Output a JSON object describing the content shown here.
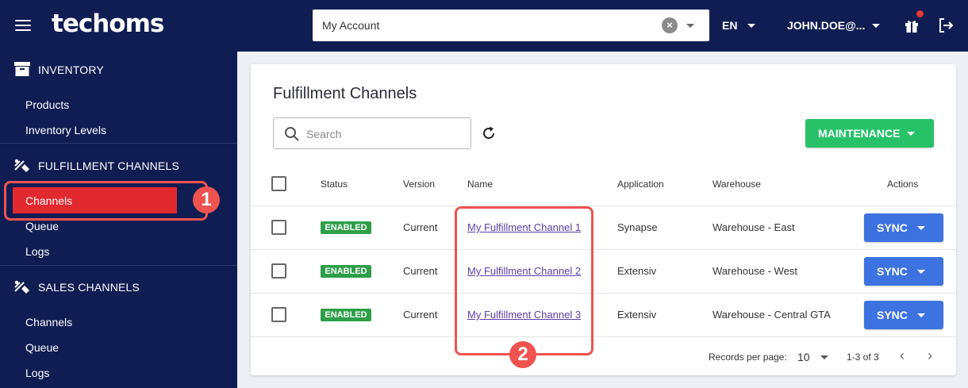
{
  "header": {
    "logo": "techoms",
    "account_value": "My Account",
    "language": "EN",
    "user": "JOHN.DOE@..."
  },
  "sidebar": {
    "inventory": {
      "title": "INVENTORY",
      "items": [
        "Products",
        "Inventory Levels"
      ]
    },
    "fulfillment": {
      "title": "FULFILLMENT CHANNELS",
      "items": [
        "Channels",
        "Queue",
        "Logs"
      ]
    },
    "sales": {
      "title": "SALES CHANNELS",
      "items": [
        "Channels",
        "Queue",
        "Logs"
      ]
    }
  },
  "annotations": {
    "one": "1",
    "two": "2"
  },
  "main": {
    "title": "Fulfillment Channels",
    "search_placeholder": "Search",
    "maintenance_label": "MAINTENANCE",
    "columns": [
      "Status",
      "Version",
      "Name",
      "Application",
      "Warehouse",
      "Actions"
    ],
    "rows": [
      {
        "status": "ENABLED",
        "version": "Current",
        "name": "My Fulfillment Channel 1",
        "application": "Synapse",
        "warehouse": "Warehouse - East",
        "action": "SYNC"
      },
      {
        "status": "ENABLED",
        "version": "Current",
        "name": "My Fulfillment Channel 2",
        "application": "Extensiv",
        "warehouse": "Warehouse - West",
        "action": "SYNC"
      },
      {
        "status": "ENABLED",
        "version": "Current",
        "name": "My Fulfillment Channel 3",
        "application": "Extensiv",
        "warehouse": "Warehouse - Central GTA",
        "action": "SYNC"
      }
    ],
    "footer": {
      "records_label": "Records per page:",
      "records_value": "10",
      "range": "1-3 of 3"
    }
  },
  "colors": {
    "navy": "#0f1d52",
    "active": "#e1292f",
    "annotation": "#ef5350",
    "enabled": "#2e9e49",
    "sync": "#3d73e0",
    "maintenance": "#27c267"
  }
}
